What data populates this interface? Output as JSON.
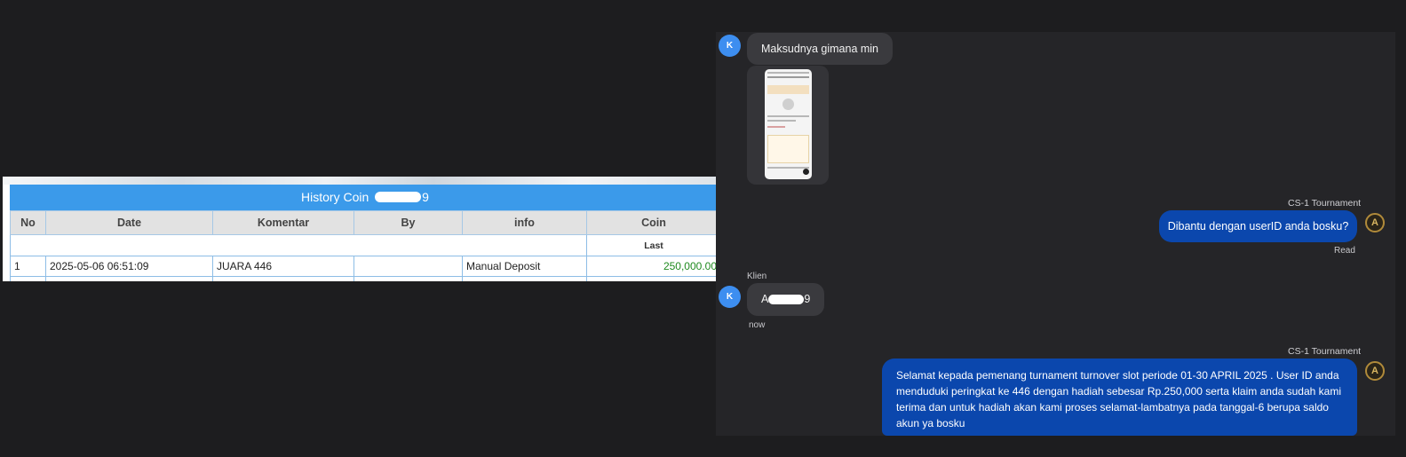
{
  "history": {
    "title_prefix": "History Coin ",
    "title_suffix": "9",
    "columns": [
      "No",
      "Date",
      "Komentar",
      "By",
      "info",
      "Coin"
    ],
    "sub_header": "Last",
    "rows": [
      {
        "no": "1",
        "date": "2025-05-06 06:51:09",
        "komentar": "JUARA 446",
        "by": "",
        "info": "Manual Deposit",
        "coin": "250,000.00"
      }
    ]
  },
  "chat": {
    "customer_avatar": "K",
    "agent_avatar": "A",
    "messages": {
      "m1": "Maksudnya gimana min",
      "agent_name_1": "CS-1 Tournament",
      "m3": "Dibantu dengan userID anda bosku?",
      "read_status": "Read",
      "sender_label": "Klien",
      "m4_prefix": "A",
      "m4_suffix": "9",
      "m4_time": "now",
      "agent_name_2": "CS-1 Tournament",
      "m5": "Selamat kepada pemenang turnament turnover slot periode 01-30 APRIL 2025 . User ID anda menduduki peringkat ke 446 dengan hadiah sebesar Rp.250,000 serta klaim anda sudah kami terima dan untuk hadiah akan kami proses selamat-lambatnya pada tanggal-6 berupa saldo akun ya bosku"
    }
  },
  "colors": {
    "page_bg": "#1d1d1f",
    "chat_bg": "#252528",
    "table_header_blue": "#3b9aea",
    "outgoing_bubble": "#0b47ad",
    "incoming_bubble": "#3a3a3e",
    "avatar_blue": "#3d8ef0",
    "coin_green": "#1f8a1f"
  }
}
